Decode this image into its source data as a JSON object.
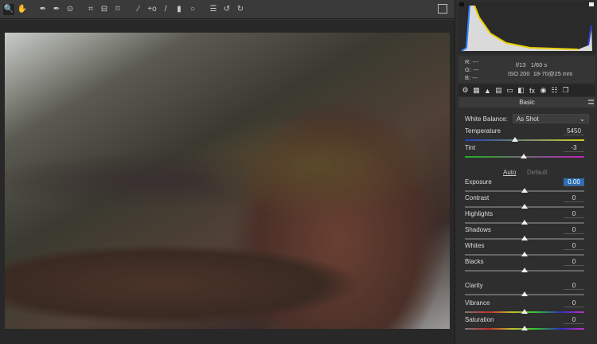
{
  "toolbar": {
    "tools": [
      {
        "name": "zoom-tool",
        "glyph": "🔍",
        "selected": true
      },
      {
        "name": "hand-tool",
        "glyph": "✋"
      },
      {
        "gap": true
      },
      {
        "name": "white-balance-tool",
        "glyph": "✒"
      },
      {
        "name": "color-sampler-tool",
        "glyph": "✒"
      },
      {
        "name": "targeted-adjustment-tool",
        "glyph": "⊙"
      },
      {
        "gap": true
      },
      {
        "name": "crop-tool",
        "glyph": "⌗"
      },
      {
        "name": "straighten-tool",
        "glyph": "⊟"
      },
      {
        "name": "transform-tool",
        "glyph": "⌑"
      },
      {
        "gap": true
      },
      {
        "name": "spot-removal-tool",
        "glyph": "⁄"
      },
      {
        "name": "red-eye-tool",
        "glyph": "+o"
      },
      {
        "name": "adjustment-brush-tool",
        "glyph": "/"
      },
      {
        "name": "graduated-filter-tool",
        "glyph": "▮"
      },
      {
        "name": "radial-filter-tool",
        "glyph": "○"
      },
      {
        "gap": true
      },
      {
        "name": "preferences-tool",
        "glyph": "☰"
      },
      {
        "name": "rotate-ccw-tool",
        "glyph": "↺"
      },
      {
        "name": "rotate-cw-tool",
        "glyph": "↻"
      }
    ]
  },
  "info": {
    "r_label": "R:",
    "g_label": "G:",
    "b_label": "B:",
    "r": "---",
    "g": "---",
    "b": "---",
    "aperture": "f/13",
    "shutter": "1/60 s",
    "iso": "ISO 200",
    "lens": "18-70@25 mm"
  },
  "tabs": [
    "⚙",
    "▦",
    "▲",
    "▤",
    "▭",
    "◧",
    "fx",
    "◉",
    "☷",
    "❐"
  ],
  "panel": {
    "title": "Basic",
    "wb_label": "White Balance:",
    "wb_value": "As Shot",
    "auto": "Auto",
    "default": "Default"
  },
  "sliders": [
    {
      "label": "Temperature",
      "value": "5450",
      "pos": 0.42,
      "track": "linear-gradient(90deg,#2040c0,#d0d020)"
    },
    {
      "label": "Tint",
      "value": "-3",
      "pos": 0.49,
      "track": "linear-gradient(90deg,#20b020,#c020c0)"
    },
    {
      "label": "Exposure",
      "value": "0.00",
      "pos": 0.5,
      "highlight": true
    },
    {
      "label": "Contrast",
      "value": "0",
      "pos": 0.5
    },
    {
      "label": "Highlights",
      "value": "0",
      "pos": 0.5
    },
    {
      "label": "Shadows",
      "value": "0",
      "pos": 0.5
    },
    {
      "label": "Whites",
      "value": "0",
      "pos": 0.5
    },
    {
      "label": "Blacks",
      "value": "0",
      "pos": 0.5
    },
    {
      "label": "Clarity",
      "value": "0",
      "pos": 0.5
    },
    {
      "label": "Vibrance",
      "value": "0",
      "pos": 0.5,
      "track": "linear-gradient(90deg,#777,#c03030,#c0c030,#30c030,#3030c0,#c030c0)"
    },
    {
      "label": "Saturation",
      "value": "0",
      "pos": 0.5,
      "track": "linear-gradient(90deg,#777,#c03030,#c0c030,#30c030,#3030c0,#c030c0)"
    }
  ]
}
